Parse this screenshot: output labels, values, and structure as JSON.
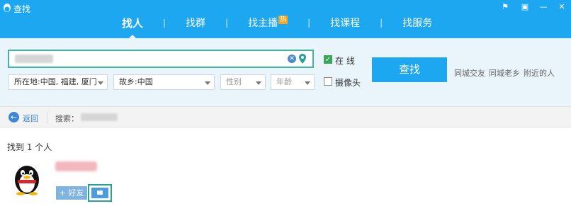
{
  "window": {
    "title": "查找",
    "controls": [
      "flag-icon",
      "lock-icon",
      "minimize-icon",
      "close-icon"
    ]
  },
  "tabs": [
    {
      "label": "找人",
      "active": true
    },
    {
      "label": "找群",
      "active": false
    },
    {
      "label": "找主播",
      "badge": "热",
      "active": false
    },
    {
      "label": "找课程",
      "active": false
    },
    {
      "label": "找服务",
      "active": false
    }
  ],
  "search": {
    "value": "",
    "online_label": "在 线",
    "online_checked": true,
    "camera_label": "摄像头",
    "camera_checked": false,
    "find_button": "查找"
  },
  "filters": {
    "location": "所在地:中国, 福建, 厦门",
    "hometown": "故乡:中国",
    "gender": "性别",
    "age": "年龄"
  },
  "quick_links": [
    "同城交友",
    "同城老乡",
    "附近的人"
  ],
  "nav": {
    "back_label": "返回",
    "search_prefix": "搜索："
  },
  "results": {
    "count_text": "找到 1 个人",
    "items": [
      {
        "add_label": "+ 好友"
      }
    ]
  },
  "colors": {
    "header": "#1da7f0",
    "panel": "#eaf4fb",
    "highlight": "#2aa196"
  }
}
